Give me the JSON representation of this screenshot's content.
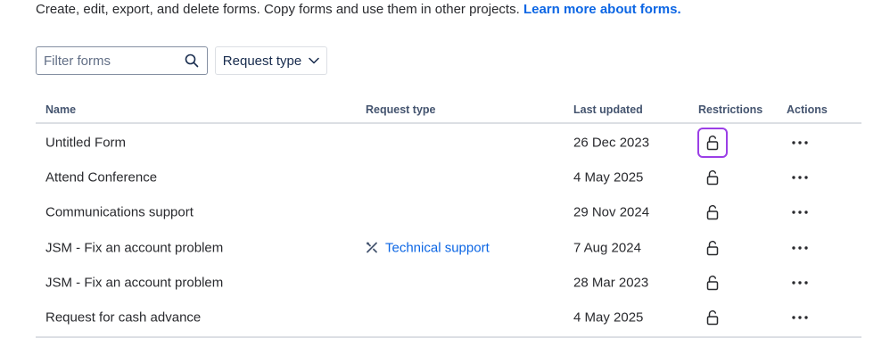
{
  "intro": {
    "text": "Create, edit, export, and delete forms. Copy forms and use them in other projects.",
    "link": "Learn more about forms."
  },
  "filter": {
    "placeholder": "Filter forms",
    "value": ""
  },
  "request_type_button": {
    "label": "Request type"
  },
  "table": {
    "headers": {
      "name": "Name",
      "request_type": "Request type",
      "last_updated": "Last updated",
      "restrictions": "Restrictions",
      "actions": "Actions"
    },
    "rows": [
      {
        "name": "Untitled Form",
        "request_type": "",
        "last_updated": "26 Dec 2023"
      },
      {
        "name": "Attend Conference",
        "request_type": "",
        "last_updated": "4 May 2025"
      },
      {
        "name": "Communications support",
        "request_type": "",
        "last_updated": "29 Nov 2024"
      },
      {
        "name": "JSM - Fix an account problem",
        "request_type": "Technical support",
        "last_updated": "7 Aug 2024"
      },
      {
        "name": "JSM - Fix an account problem",
        "request_type": "",
        "last_updated": "28 Mar 2023"
      },
      {
        "name": "Request for cash advance",
        "request_type": "",
        "last_updated": "4 May 2025"
      }
    ]
  },
  "colors": {
    "link": "#0c66e4",
    "focus_ring": "#9b3fe6",
    "divider": "#dcdfe4"
  },
  "icons": {
    "search": "search-icon",
    "chevron": "chevron-down-icon",
    "lock": "unlock-icon",
    "more": "more-icon",
    "request_type": "tools-icon"
  }
}
